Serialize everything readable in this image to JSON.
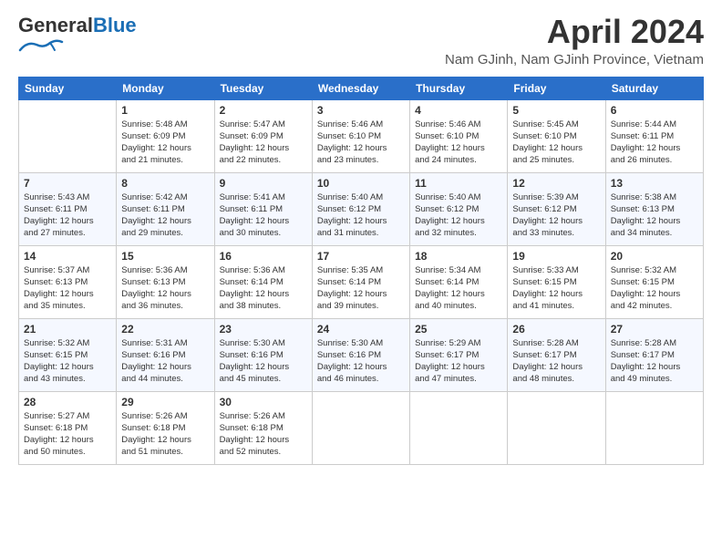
{
  "header": {
    "logo_general": "General",
    "logo_blue": "Blue",
    "month_title": "April 2024",
    "location": "Nam GJinh, Nam GJinh Province, Vietnam"
  },
  "weekdays": [
    "Sunday",
    "Monday",
    "Tuesday",
    "Wednesday",
    "Thursday",
    "Friday",
    "Saturday"
  ],
  "weeks": [
    [
      {
        "day": "",
        "info": ""
      },
      {
        "day": "1",
        "info": "Sunrise: 5:48 AM\nSunset: 6:09 PM\nDaylight: 12 hours\nand 21 minutes."
      },
      {
        "day": "2",
        "info": "Sunrise: 5:47 AM\nSunset: 6:09 PM\nDaylight: 12 hours\nand 22 minutes."
      },
      {
        "day": "3",
        "info": "Sunrise: 5:46 AM\nSunset: 6:10 PM\nDaylight: 12 hours\nand 23 minutes."
      },
      {
        "day": "4",
        "info": "Sunrise: 5:46 AM\nSunset: 6:10 PM\nDaylight: 12 hours\nand 24 minutes."
      },
      {
        "day": "5",
        "info": "Sunrise: 5:45 AM\nSunset: 6:10 PM\nDaylight: 12 hours\nand 25 minutes."
      },
      {
        "day": "6",
        "info": "Sunrise: 5:44 AM\nSunset: 6:11 PM\nDaylight: 12 hours\nand 26 minutes."
      }
    ],
    [
      {
        "day": "7",
        "info": "Sunrise: 5:43 AM\nSunset: 6:11 PM\nDaylight: 12 hours\nand 27 minutes."
      },
      {
        "day": "8",
        "info": "Sunrise: 5:42 AM\nSunset: 6:11 PM\nDaylight: 12 hours\nand 29 minutes."
      },
      {
        "day": "9",
        "info": "Sunrise: 5:41 AM\nSunset: 6:11 PM\nDaylight: 12 hours\nand 30 minutes."
      },
      {
        "day": "10",
        "info": "Sunrise: 5:40 AM\nSunset: 6:12 PM\nDaylight: 12 hours\nand 31 minutes."
      },
      {
        "day": "11",
        "info": "Sunrise: 5:40 AM\nSunset: 6:12 PM\nDaylight: 12 hours\nand 32 minutes."
      },
      {
        "day": "12",
        "info": "Sunrise: 5:39 AM\nSunset: 6:12 PM\nDaylight: 12 hours\nand 33 minutes."
      },
      {
        "day": "13",
        "info": "Sunrise: 5:38 AM\nSunset: 6:13 PM\nDaylight: 12 hours\nand 34 minutes."
      }
    ],
    [
      {
        "day": "14",
        "info": "Sunrise: 5:37 AM\nSunset: 6:13 PM\nDaylight: 12 hours\nand 35 minutes."
      },
      {
        "day": "15",
        "info": "Sunrise: 5:36 AM\nSunset: 6:13 PM\nDaylight: 12 hours\nand 36 minutes."
      },
      {
        "day": "16",
        "info": "Sunrise: 5:36 AM\nSunset: 6:14 PM\nDaylight: 12 hours\nand 38 minutes."
      },
      {
        "day": "17",
        "info": "Sunrise: 5:35 AM\nSunset: 6:14 PM\nDaylight: 12 hours\nand 39 minutes."
      },
      {
        "day": "18",
        "info": "Sunrise: 5:34 AM\nSunset: 6:14 PM\nDaylight: 12 hours\nand 40 minutes."
      },
      {
        "day": "19",
        "info": "Sunrise: 5:33 AM\nSunset: 6:15 PM\nDaylight: 12 hours\nand 41 minutes."
      },
      {
        "day": "20",
        "info": "Sunrise: 5:32 AM\nSunset: 6:15 PM\nDaylight: 12 hours\nand 42 minutes."
      }
    ],
    [
      {
        "day": "21",
        "info": "Sunrise: 5:32 AM\nSunset: 6:15 PM\nDaylight: 12 hours\nand 43 minutes."
      },
      {
        "day": "22",
        "info": "Sunrise: 5:31 AM\nSunset: 6:16 PM\nDaylight: 12 hours\nand 44 minutes."
      },
      {
        "day": "23",
        "info": "Sunrise: 5:30 AM\nSunset: 6:16 PM\nDaylight: 12 hours\nand 45 minutes."
      },
      {
        "day": "24",
        "info": "Sunrise: 5:30 AM\nSunset: 6:16 PM\nDaylight: 12 hours\nand 46 minutes."
      },
      {
        "day": "25",
        "info": "Sunrise: 5:29 AM\nSunset: 6:17 PM\nDaylight: 12 hours\nand 47 minutes."
      },
      {
        "day": "26",
        "info": "Sunrise: 5:28 AM\nSunset: 6:17 PM\nDaylight: 12 hours\nand 48 minutes."
      },
      {
        "day": "27",
        "info": "Sunrise: 5:28 AM\nSunset: 6:17 PM\nDaylight: 12 hours\nand 49 minutes."
      }
    ],
    [
      {
        "day": "28",
        "info": "Sunrise: 5:27 AM\nSunset: 6:18 PM\nDaylight: 12 hours\nand 50 minutes."
      },
      {
        "day": "29",
        "info": "Sunrise: 5:26 AM\nSunset: 6:18 PM\nDaylight: 12 hours\nand 51 minutes."
      },
      {
        "day": "30",
        "info": "Sunrise: 5:26 AM\nSunset: 6:18 PM\nDaylight: 12 hours\nand 52 minutes."
      },
      {
        "day": "",
        "info": ""
      },
      {
        "day": "",
        "info": ""
      },
      {
        "day": "",
        "info": ""
      },
      {
        "day": "",
        "info": ""
      }
    ]
  ]
}
